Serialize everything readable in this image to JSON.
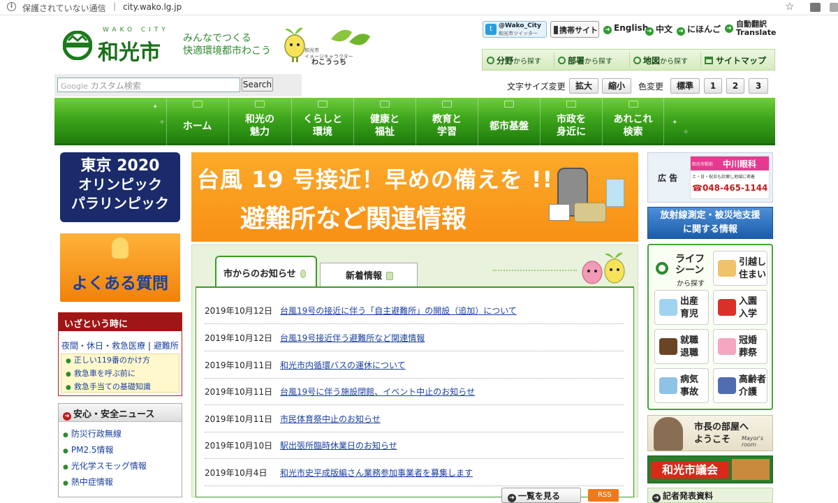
{
  "browser": {
    "security": "保護されていない通信",
    "separator": "|",
    "url": "city.wako.lg.jp",
    "bookmark_icon": "star-icon"
  },
  "header": {
    "logo_sub": "WAKO CITY",
    "logo_name": "和光市",
    "tagline_1": "みんなでつくる",
    "tagline_2": "快適環境都市わこう",
    "mascot_caption_1": "和光市",
    "mascot_caption_2": "イメージキャラクター",
    "mascot_name": "わこうっち",
    "twitter_handle": "@Wako_City",
    "twitter_sub": "和光市ツイッター",
    "mobile_site": "携帯サイト",
    "lang_en": "English",
    "lang_zh": "中文",
    "lang_ja": "にほんご",
    "auto_translate_1": "自動翻訳",
    "auto_translate_2": "Translate"
  },
  "find": {
    "by_field": "分野",
    "by_dept": "部署",
    "by_map": "地図",
    "suffix": "から探す",
    "sitemap": "サイトマップ"
  },
  "search": {
    "google": "Google",
    "placeholder": "カスタム検索",
    "button": "Search"
  },
  "text_tools": {
    "font_size_label": "文字サイズ変更",
    "enlarge": "拡大",
    "shrink": "縮小",
    "color_label": "色変更",
    "standard": "標準",
    "c1": "1",
    "c2": "2",
    "c3": "3"
  },
  "nav": [
    {
      "l1": "ホーム",
      "l2": ""
    },
    {
      "l1": "和光の",
      "l2": "魅力"
    },
    {
      "l1": "くらしと",
      "l2": "環境"
    },
    {
      "l1": "健康と",
      "l2": "福祉"
    },
    {
      "l1": "教育と",
      "l2": "学習"
    },
    {
      "l1": "都市基盤",
      "l2": ""
    },
    {
      "l1": "市政を",
      "l2": "身近に"
    },
    {
      "l1": "あれこれ",
      "l2": "検索"
    }
  ],
  "left": {
    "olympic_1": "東京 2020",
    "olympic_2": "オリンピック",
    "olympic_3": "パラリンピック",
    "faq": "よくある質問",
    "emergency_title": "いざという時に",
    "emergency_link_1": "夜間・休日・救急医療",
    "emergency_link_sep": "|",
    "emergency_link_2": "避難所",
    "emergency_items": [
      "正しい119番のかけ方",
      "救急車を呼ぶ前に",
      "救急手当ての基礎知識"
    ],
    "safety_title": "安心・安全ニュース",
    "safety_items": [
      "防災行政無線",
      "PM2.5情報",
      "光化学スモッグ情報",
      "熱中症情報"
    ]
  },
  "banner": {
    "line1": "台風 19 号接近！早めの備えを !!",
    "line2": "避難所など関連情報"
  },
  "notices": {
    "tab_active": "市からのお知らせ",
    "tab_other": "新着情報",
    "items": [
      {
        "date": "2019年10月12日",
        "title": "台風19号の接近に伴う「自主避難所」の開設（追加）について"
      },
      {
        "date": "2019年10月12日",
        "title": "台風19号接近伴う避難所など関連情報"
      },
      {
        "date": "2019年10月11日",
        "title": "和光市内循環バスの運休について"
      },
      {
        "date": "2019年10月11日",
        "title": "台風19号に伴う施設閉館、イベント中止のお知らせ"
      },
      {
        "date": "2019年10月11日",
        "title": "市民体育祭中止のお知らせ"
      },
      {
        "date": "2019年10月10日",
        "title": "駅出張所臨時休業日のお知らせ"
      },
      {
        "date": "2019年10月4日",
        "title": "和光市史平成版編さん業務参加事業者を募集します"
      }
    ],
    "more": "一覧を見る",
    "rss": "RSS"
  },
  "right": {
    "ad_label": "広 告",
    "ad_sub": "和光市駅前",
    "ad_name": "中川眼科",
    "ad_hours": "土・日・祝日も診療し地域に密着",
    "ad_phone": "☎048-465-1144",
    "radiation_1": "放射線測定・被災地支援",
    "radiation_2": "に関する情報",
    "life_title_1": "ライフ",
    "life_title_2": "シーン",
    "life_sub": "から探す",
    "life_buttons": [
      {
        "l1": "引越し",
        "l2": "住まい"
      },
      {
        "l1": "出産",
        "l2": "育児"
      },
      {
        "l1": "入園",
        "l2": "入学"
      },
      {
        "l1": "就職",
        "l2": "退職"
      },
      {
        "l1": "冠婚",
        "l2": "葬祭"
      },
      {
        "l1": "病気",
        "l2": "事故"
      },
      {
        "l1": "高齢者",
        "l2": "介護"
      }
    ],
    "mayor_1": "市長の部屋へ",
    "mayor_2": "ようこそ",
    "mayor_en": "Mayor's room",
    "council": "和光市議会",
    "press": "記者発表資料"
  },
  "colors": {
    "nav_green": "#3ea51c",
    "banner_orange": "#f89015",
    "emergency_red": "#a01515",
    "link_blue": "#1a3fa0"
  }
}
